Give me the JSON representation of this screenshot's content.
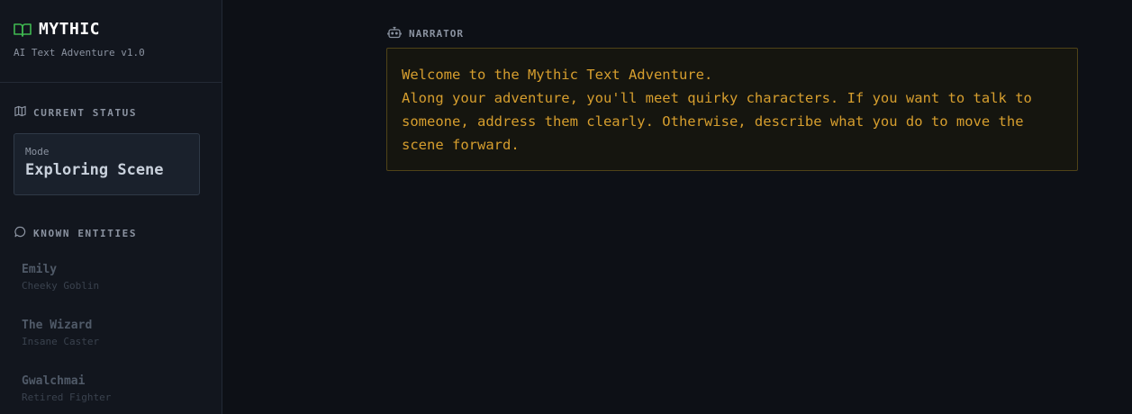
{
  "brand": {
    "title": "MYTHIC",
    "subtitle": "AI Text Adventure v1.0",
    "icon": "book-icon",
    "accent": "#3fb950"
  },
  "status": {
    "heading": "CURRENT STATUS",
    "icon": "map-icon",
    "mode_label": "Mode",
    "mode_value": "Exploring Scene"
  },
  "entities": {
    "heading": "KNOWN ENTITIES",
    "icon": "chat-bubble-icon",
    "items": [
      {
        "name": "Emily",
        "role": "Cheeky Goblin"
      },
      {
        "name": "The Wizard",
        "role": "Insane Caster"
      },
      {
        "name": "Gwalchmai",
        "role": "Retired Fighter"
      }
    ]
  },
  "narrator": {
    "heading": "NARRATOR",
    "icon": "robot-icon",
    "color": "#d69e2e",
    "lines": [
      "Welcome to the Mythic Text Adventure.",
      "Along your adventure, you'll meet quirky characters. If you want to talk to someone, address them clearly. Otherwise, describe what you do to move the scene forward."
    ]
  }
}
